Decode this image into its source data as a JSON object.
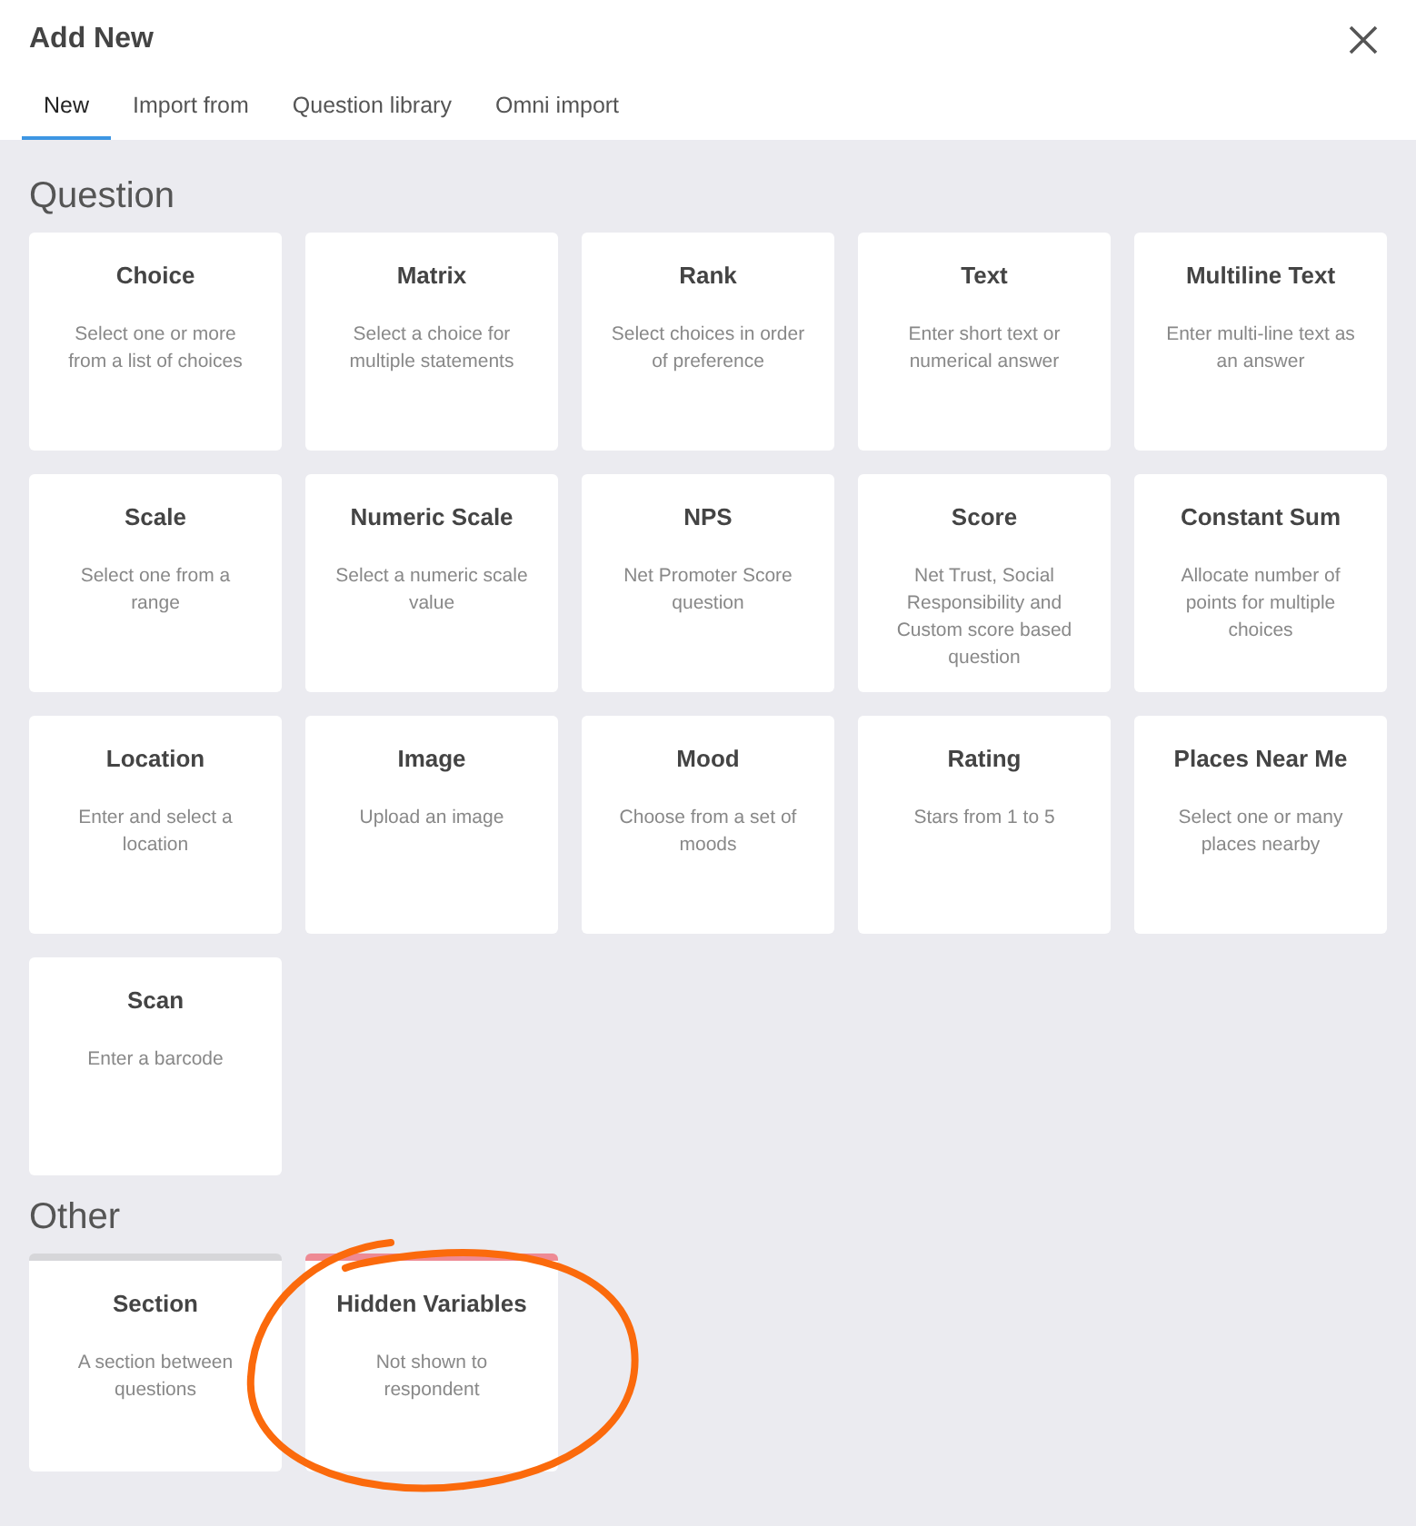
{
  "window": {
    "title": "Add New"
  },
  "tabs": [
    {
      "label": "New",
      "selected": true
    },
    {
      "label": "Import from",
      "selected": false
    },
    {
      "label": "Question library",
      "selected": false
    },
    {
      "label": "Omni import",
      "selected": false
    }
  ],
  "sections": [
    {
      "heading": "Question",
      "items": [
        {
          "title": "Choice",
          "description": "Select one or more from a list of choices"
        },
        {
          "title": "Matrix",
          "description": "Select a choice for multiple statements"
        },
        {
          "title": "Rank",
          "description": "Select choices in order of preference"
        },
        {
          "title": "Text",
          "description": "Enter short text or numerical answer"
        },
        {
          "title": "Multiline Text",
          "description": "Enter multi-line text as an answer"
        },
        {
          "title": "Scale",
          "description": "Select one from a range"
        },
        {
          "title": "Numeric Scale",
          "description": "Select a numeric scale value"
        },
        {
          "title": "NPS",
          "description": "Net Promoter Score question"
        },
        {
          "title": "Score",
          "description": "Net Trust, Social Responsibility and Custom score based question"
        },
        {
          "title": "Constant Sum",
          "description": "Allocate number of points for multiple choices"
        },
        {
          "title": "Location",
          "description": "Enter and select a location"
        },
        {
          "title": "Image",
          "description": "Upload an image"
        },
        {
          "title": "Mood",
          "description": "Choose from a set of moods"
        },
        {
          "title": "Rating",
          "description": "Stars from 1 to 5"
        },
        {
          "title": "Places Near Me",
          "description": "Select one or many places nearby"
        },
        {
          "title": "Scan",
          "description": "Enter a barcode"
        }
      ]
    },
    {
      "heading": "Other",
      "items": [
        {
          "title": "Section",
          "description": "A section between questions",
          "color": "#d6d6d9"
        },
        {
          "title": "Hidden Variables",
          "description": "Not shown to respondent",
          "color": "#ee8a94",
          "circled": true
        }
      ]
    }
  ]
}
